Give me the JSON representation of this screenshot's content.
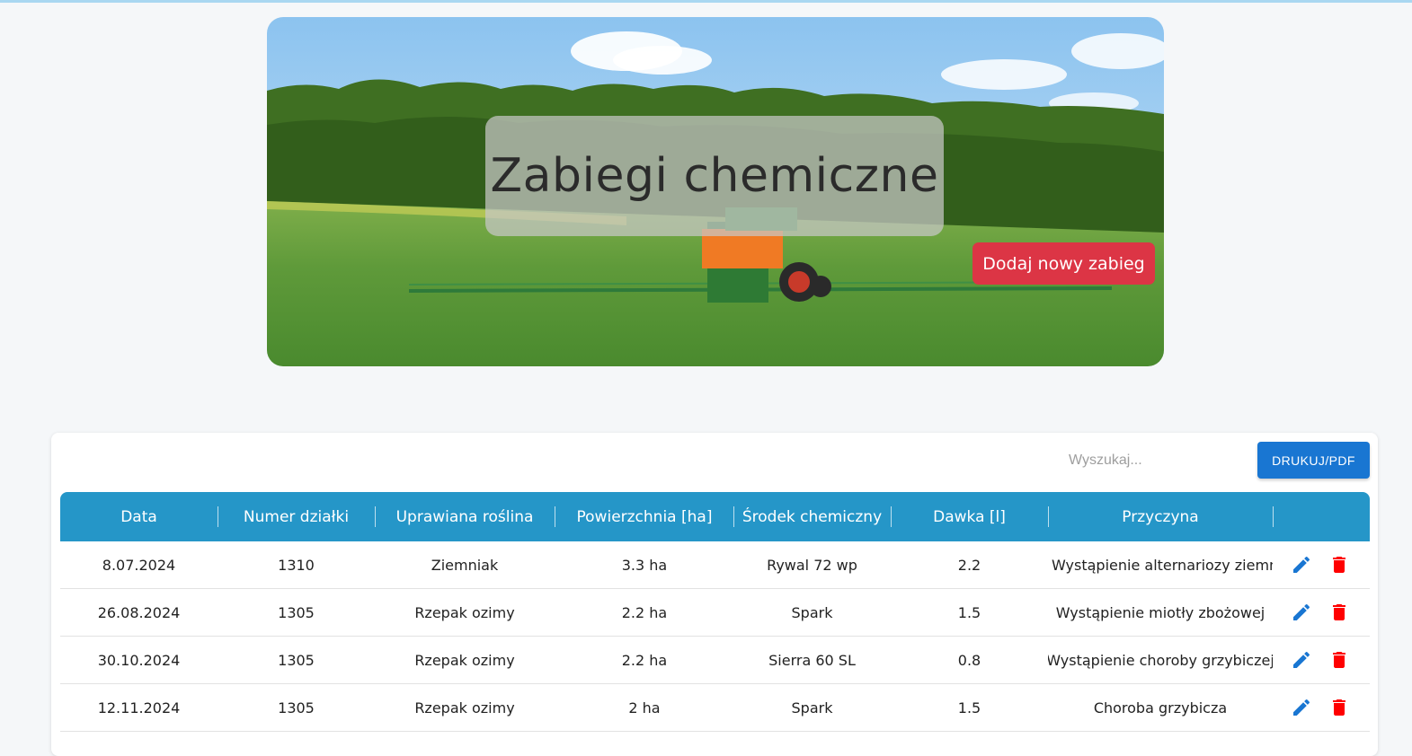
{
  "hero": {
    "title": "Zabiegi chemiczne",
    "add_button": "Dodaj nowy zabieg"
  },
  "toolbar": {
    "search_placeholder": "Wyszukaj...",
    "print_button": "DRUKUJ/PDF"
  },
  "table": {
    "columns": [
      "Data",
      "Numer działki",
      "Uprawiana roślina",
      "Powierzchnia [ha]",
      "Środek chemiczny",
      "Dawka [l]",
      "Przyczyna"
    ],
    "rows": [
      [
        "8.07.2024",
        "1310",
        "Ziemniak",
        "3.3 ha",
        "Rywal 72 wp",
        "2.2",
        "Wystąpienie alternariozy ziemniaka"
      ],
      [
        "26.08.2024",
        "1305",
        "Rzepak ozimy",
        "2.2 ha",
        "Spark",
        "1.5",
        "Wystąpienie miotły zbożowej"
      ],
      [
        "30.10.2024",
        "1305",
        "Rzepak ozimy",
        "2.2 ha",
        "Sierra 60 SL",
        "0.8",
        "Wystąpienie choroby grzybiczej"
      ],
      [
        "12.11.2024",
        "1305",
        "Rzepak ozimy",
        "2 ha",
        "Spark",
        "1.5",
        "Choroba grzybicza"
      ]
    ],
    "row_actions": [
      "edit-icon",
      "delete-icon"
    ]
  },
  "colors": {
    "header": "#2596c8",
    "add_button": "#dc3545",
    "print_button": "#1976d2",
    "edit_icon": "#1976d2",
    "delete_icon": "#ff0000"
  }
}
